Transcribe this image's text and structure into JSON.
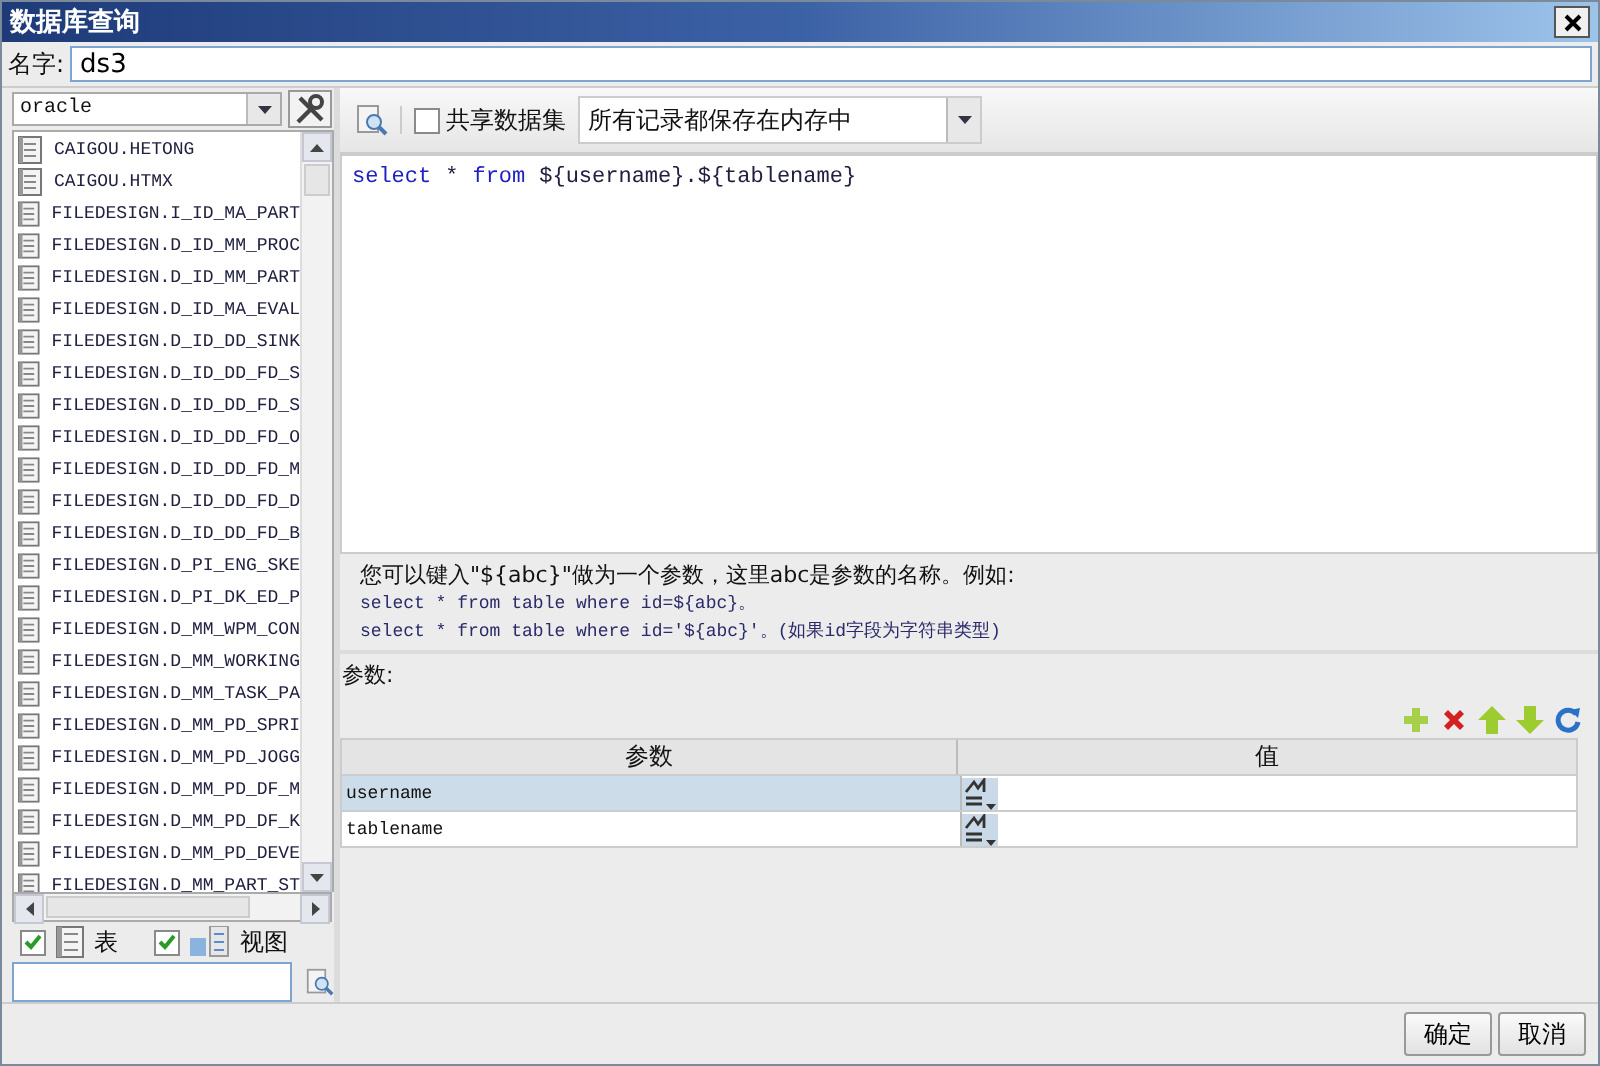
{
  "window": {
    "title": "数据库查询"
  },
  "name_field": {
    "label": "名字:",
    "value": "ds3"
  },
  "connection": {
    "value": "oracle"
  },
  "tables": [
    {
      "name": "CAIGOU.HETONG"
    },
    {
      "name": "CAIGOU.HTMX"
    },
    {
      "name": "FILEDESIGN.I_ID_MA_PART"
    },
    {
      "name": "FILEDESIGN.D_ID_MM_PROC"
    },
    {
      "name": "FILEDESIGN.D_ID_MM_PART"
    },
    {
      "name": "FILEDESIGN.D_ID_MA_EVAL"
    },
    {
      "name": "FILEDESIGN.D_ID_DD_SINK"
    },
    {
      "name": "FILEDESIGN.D_ID_DD_FD_S"
    },
    {
      "name": "FILEDESIGN.D_ID_DD_FD_S"
    },
    {
      "name": "FILEDESIGN.D_ID_DD_FD_O"
    },
    {
      "name": "FILEDESIGN.D_ID_DD_FD_M"
    },
    {
      "name": "FILEDESIGN.D_ID_DD_FD_D"
    },
    {
      "name": "FILEDESIGN.D_ID_DD_FD_B"
    },
    {
      "name": "FILEDESIGN.D_PI_ENG_SKE"
    },
    {
      "name": "FILEDESIGN.D_PI_DK_ED_P"
    },
    {
      "name": "FILEDESIGN.D_MM_WPM_CON"
    },
    {
      "name": "FILEDESIGN.D_MM_WORKING"
    },
    {
      "name": "FILEDESIGN.D_MM_TASK_PA"
    },
    {
      "name": "FILEDESIGN.D_MM_PD_SPRI"
    },
    {
      "name": "FILEDESIGN.D_MM_PD_JOGG"
    },
    {
      "name": "FILEDESIGN.D_MM_PD_DF_M"
    },
    {
      "name": "FILEDESIGN.D_MM_PD_DF_K"
    },
    {
      "name": "FILEDESIGN.D_MM_PD_DEVE"
    },
    {
      "name": "FILEDESIGN.D_MM_PART_ST"
    }
  ],
  "filters": [
    {
      "label": "表",
      "checked": true,
      "kind": "table"
    },
    {
      "label": "视图",
      "checked": true,
      "kind": "view"
    }
  ],
  "share_dataset": {
    "label": "共享数据集",
    "checked": false
  },
  "storage_mode": {
    "value": "所有记录都保存在内存中"
  },
  "sql_tokens": [
    {
      "text": "select",
      "kind": "keyword"
    },
    {
      "text": "*",
      "kind": "plain"
    },
    {
      "text": "from",
      "kind": "keyword"
    },
    {
      "text": "${username}.${tablename}",
      "kind": "plain"
    }
  ],
  "hint": [
    "您可以键入\"${abc}\"做为一个参数，这里abc是参数的名称。例如:",
    "select * from table where id=${abc}。",
    "select * from table where id='${abc}'。(如果id字段为字符串类型)"
  ],
  "parameters": {
    "label": "参数:",
    "columns": [
      "参数",
      "值"
    ],
    "rows": [
      {
        "name": "username",
        "selected": true
      },
      {
        "name": "tablename",
        "selected": false
      }
    ]
  },
  "buttons": [
    "确定",
    "取消"
  ]
}
